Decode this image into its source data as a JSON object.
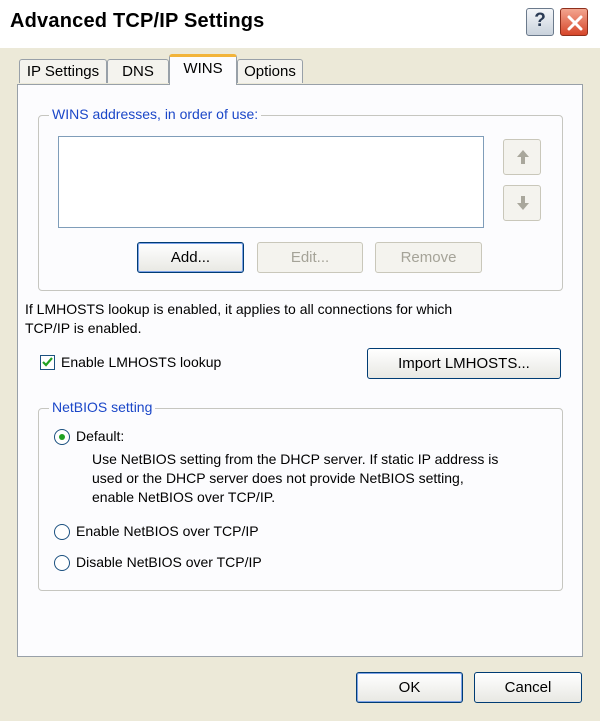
{
  "window": {
    "title": "Advanced TCP/IP Settings",
    "help_glyph": "?"
  },
  "tabs": [
    {
      "label": "IP Settings"
    },
    {
      "label": "DNS"
    },
    {
      "label": "WINS",
      "active": true
    },
    {
      "label": "Options"
    }
  ],
  "wins": {
    "group_label": "WINS addresses, in order of use:",
    "addresses": [],
    "add_label": "Add...",
    "edit_label": "Edit...",
    "remove_label": "Remove",
    "up_icon": "arrow-up-icon",
    "down_icon": "arrow-down-icon"
  },
  "lmhosts": {
    "info_line1": "If LMHOSTS lookup is enabled, it applies to all connections for which",
    "info_line2": "TCP/IP is enabled.",
    "enable_label": "Enable LMHOSTS lookup",
    "enable_checked": true,
    "import_label": "Import LMHOSTS..."
  },
  "netbios": {
    "group_label": "NetBIOS setting",
    "default_label": "Default:",
    "default_desc_line1": "Use NetBIOS setting from the DHCP server. If static IP address is",
    "default_desc_line2": "used or the DHCP server does not provide NetBIOS setting,",
    "default_desc_line3": "enable NetBIOS over TCP/IP.",
    "enable_label": "Enable NetBIOS over TCP/IP",
    "disable_label": "Disable NetBIOS over TCP/IP",
    "selected": "default"
  },
  "footer": {
    "ok_label": "OK",
    "cancel_label": "Cancel"
  },
  "colors": {
    "accent_tab": "#f2b43a",
    "group_label": "#1b47c8",
    "radio_dot": "#21a121",
    "check": "#21a121"
  }
}
